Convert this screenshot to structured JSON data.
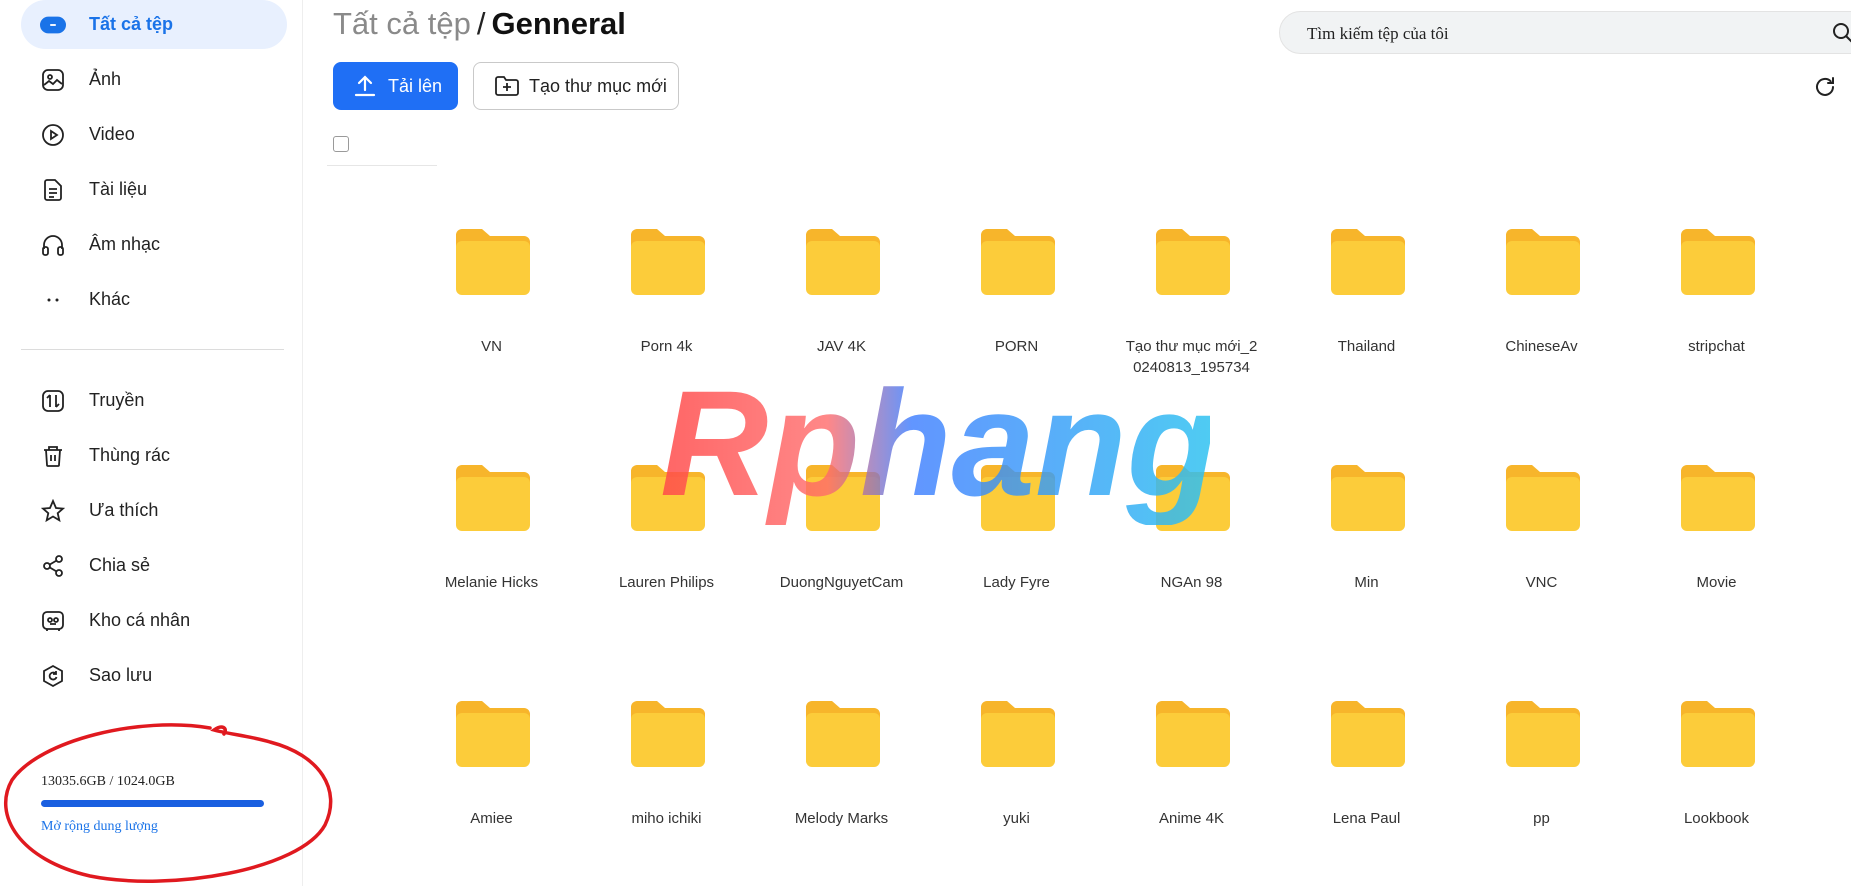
{
  "sidebar": {
    "primary": [
      {
        "label": "Tất cả tệp",
        "icon": "all-files-icon"
      },
      {
        "label": "Ảnh",
        "icon": "image-icon"
      },
      {
        "label": "Video",
        "icon": "video-icon"
      },
      {
        "label": "Tài liệu",
        "icon": "document-icon"
      },
      {
        "label": "Âm nhạc",
        "icon": "headphones-icon"
      },
      {
        "label": "Khác",
        "icon": "more-dots-icon"
      }
    ],
    "secondary": [
      {
        "label": "Truyền",
        "icon": "transfer-icon"
      },
      {
        "label": "Thùng rác",
        "icon": "trash-icon"
      },
      {
        "label": "Ưa thích",
        "icon": "star-icon"
      },
      {
        "label": "Chia sẻ",
        "icon": "share-icon"
      },
      {
        "label": "Kho cá nhân",
        "icon": "personal-vault-icon"
      },
      {
        "label": "Sao lưu",
        "icon": "backup-icon"
      }
    ],
    "storage": {
      "usage_text": "13035.6GB / 1024.0GB",
      "expand_label": "Mở rộng dung lượng",
      "fill_fraction": 1.0,
      "bar_color": "#1a5fe0",
      "annotation_color": "#e0191f"
    }
  },
  "header": {
    "breadcrumb_root": "Tất cả tệp",
    "breadcrumb_sep": "/",
    "breadcrumb_current": "Genneral",
    "search_placeholder": "Tìm kiếm tệp của tôi"
  },
  "toolbar": {
    "upload_label": "Tải lên",
    "new_folder_label": "Tạo thư mục mới"
  },
  "folders": [
    "VN",
    "Porn 4k",
    "JAV 4K",
    "PORN",
    "Tạo thư mục mới_20240813_195734",
    "Thailand",
    "ChineseAv",
    "stripchat",
    "Melanie Hicks",
    "Lauren Philips",
    "DuongNguyetCam",
    "Lady Fyre",
    "NGAn 98",
    "Min",
    "VNC",
    "Movie",
    "Amiee",
    "miho ichiki",
    "Melody Marks",
    "yuki",
    "Anime 4K",
    "Lena Paul",
    "pp",
    "Lookbook"
  ],
  "folder_labels_display": {
    "4": [
      "Tạo thư mục mới_2",
      "0240813_195734"
    ]
  },
  "watermark": {
    "text": "Rphang"
  },
  "colors": {
    "accent": "#1a73e8",
    "active_bg": "#e8f0fe",
    "folder": "#fccc3a",
    "folder_tab": "#f7b52b"
  }
}
